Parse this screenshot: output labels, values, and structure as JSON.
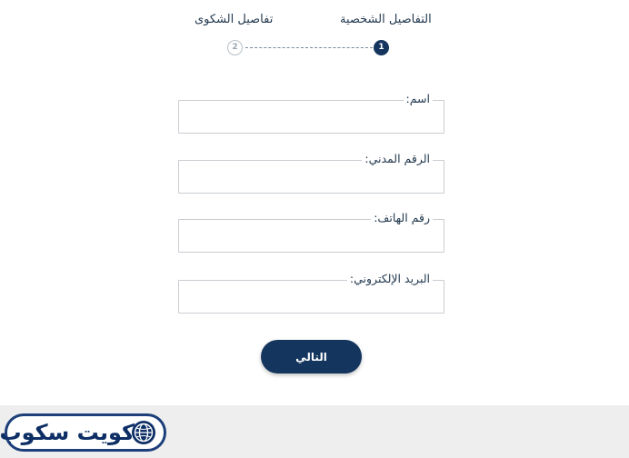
{
  "stepper": {
    "steps": [
      {
        "number": "1",
        "label": "التفاصيل الشخصية",
        "state": "active"
      },
      {
        "number": "2",
        "label": "تفاصيل الشكوى",
        "state": "inactive"
      }
    ]
  },
  "form": {
    "fields": [
      {
        "label": "اسم:",
        "value": ""
      },
      {
        "label": "الرقم المدني:",
        "value": ""
      },
      {
        "label": "رقم الهاتف:",
        "value": ""
      },
      {
        "label": "البريد الإلكتروني:",
        "value": ""
      }
    ],
    "next_label": "التالي"
  },
  "footer": {
    "logo_text": "كويت سكوب",
    "logo_icon": "globe-icon"
  },
  "colors": {
    "primary": "#13355e",
    "field_border": "#c9cdd2",
    "footer_background": "#eeeeee",
    "logo_blue": "#1d3f7a"
  }
}
